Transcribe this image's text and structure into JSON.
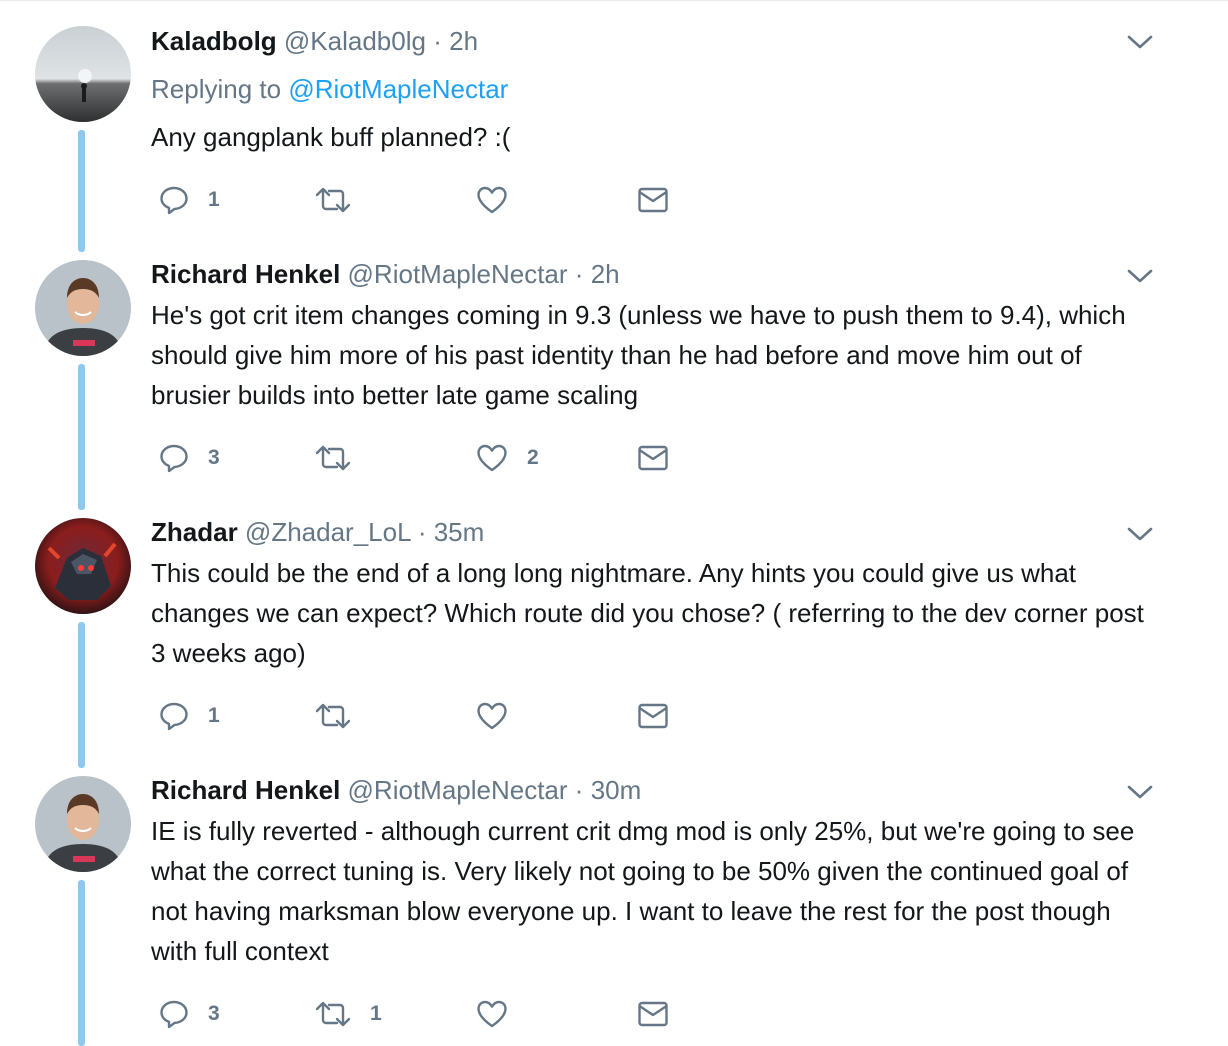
{
  "colors": {
    "accent": "#1da1f2",
    "thread_line": "#8ec8f0",
    "secondary_text": "#657786",
    "primary_text": "#14171a"
  },
  "tweets": [
    {
      "name": "Kaladbolg",
      "handle": "@Kaladb0lg",
      "dot": "·",
      "time": "2h",
      "reply_prefix": "Replying to",
      "reply_to": "@RiotMapleNectar",
      "text": "Any gangplank buff planned? :(",
      "counts": {
        "reply": "1",
        "retweet": "",
        "like": ""
      }
    },
    {
      "name": "Richard Henkel",
      "handle": "@RiotMapleNectar",
      "dot": "·",
      "time": "2h",
      "text": "He's got crit item changes coming in 9.3 (unless we have to push them to 9.4), which should give him more of his past identity than he had before and move him out of brusier builds into better late game scaling",
      "counts": {
        "reply": "3",
        "retweet": "",
        "like": "2"
      }
    },
    {
      "name": "Zhadar",
      "handle": "@Zhadar_LoL",
      "dot": "·",
      "time": "35m",
      "text": "This could be the end of a long long nightmare. Any hints you could give us what changes we can expect? Which route did you chose? ( referring to the dev corner post 3 weeks ago)",
      "counts": {
        "reply": "1",
        "retweet": "",
        "like": ""
      }
    },
    {
      "name": "Richard Henkel",
      "handle": "@RiotMapleNectar",
      "dot": "·",
      "time": "30m",
      "text": "IE is fully reverted - although current crit dmg mod is only 25%, but we're going to see what the correct tuning is. Very likely not going to be 50% given the continued goal of not having marksman blow everyone up. I want to leave the rest for the post though with full context",
      "counts": {
        "reply": "3",
        "retweet": "1",
        "like": ""
      }
    }
  ],
  "icons": {
    "reply": "reply-icon",
    "retweet": "retweet-icon",
    "like": "heart-icon",
    "dm": "envelope-icon",
    "menu": "chevron-down-icon"
  }
}
